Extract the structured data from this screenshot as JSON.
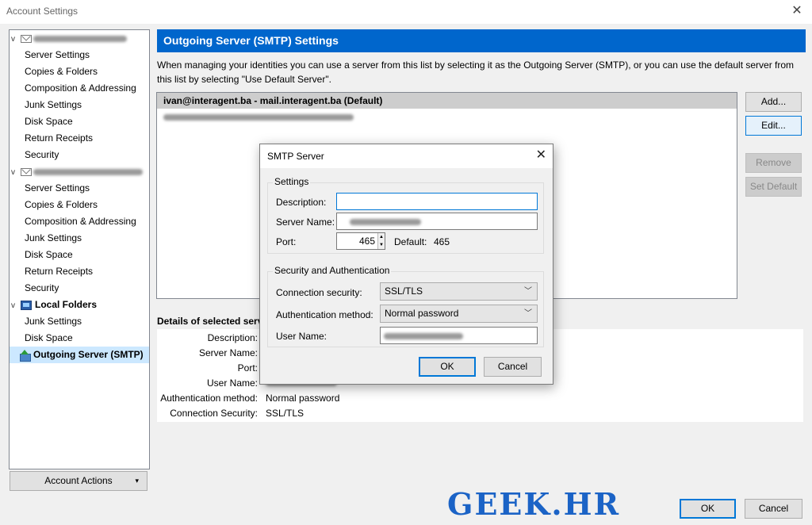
{
  "window": {
    "title": "Account Settings",
    "close_glyph": "✕"
  },
  "tree": {
    "accounts": [
      {
        "twisty": "v",
        "items": [
          "Server Settings",
          "Copies & Folders",
          "Composition & Addressing",
          "Junk Settings",
          "Disk Space",
          "Return Receipts",
          "Security"
        ]
      },
      {
        "twisty": "v",
        "items": [
          "Server Settings",
          "Copies & Folders",
          "Composition & Addressing",
          "Junk Settings",
          "Disk Space",
          "Return Receipts",
          "Security"
        ]
      }
    ],
    "local_folders": {
      "twisty": "v",
      "label": "Local Folders",
      "items": [
        "Junk Settings",
        "Disk Space"
      ]
    },
    "outgoing": "Outgoing Server (SMTP)"
  },
  "account_actions": {
    "label": "Account Actions",
    "arrow": "▾"
  },
  "panel": {
    "title": "Outgoing Server (SMTP) Settings",
    "description": "When managing your identities you can use a server from this list by selecting it as the Outgoing Server (SMTP), or you can use the default server from this list by selecting \"Use Default Server\".",
    "servers": [
      "ivan@interagent.ba - mail.interagent.ba (Default)"
    ],
    "buttons": {
      "add": "Add...",
      "edit": "Edit...",
      "remove": "Remove",
      "set_default": "Set Default"
    }
  },
  "details": {
    "label": "Details of selected serve",
    "rows": [
      {
        "key": "Description:",
        "value": ""
      },
      {
        "key": "Server Name:",
        "value": ""
      },
      {
        "key": "Port:",
        "value": ""
      },
      {
        "key": "User Name:",
        "value": ""
      },
      {
        "key": "Authentication method:",
        "value": "Normal password"
      },
      {
        "key": "Connection Security:",
        "value": "SSL/TLS"
      }
    ]
  },
  "dialog": {
    "title": "SMTP Server",
    "close_glyph": "✕",
    "settings_group": "Settings",
    "description_label": "Description:",
    "description_value": "",
    "server_name_label": "Server Name:",
    "port_label": "Port:",
    "port_value": "465",
    "port_default_label": "Default:",
    "port_default_value": "465",
    "security_group": "Security and Authentication",
    "connection_security_label": "Connection security:",
    "connection_security_value": "SSL/TLS",
    "auth_method_label": "Authentication method:",
    "auth_method_value": "Normal password",
    "user_name_label": "User Name:",
    "ok": "OK",
    "cancel": "Cancel"
  },
  "footer": {
    "ok": "OK",
    "cancel": "Cancel"
  },
  "watermark": "GEEK.HR"
}
